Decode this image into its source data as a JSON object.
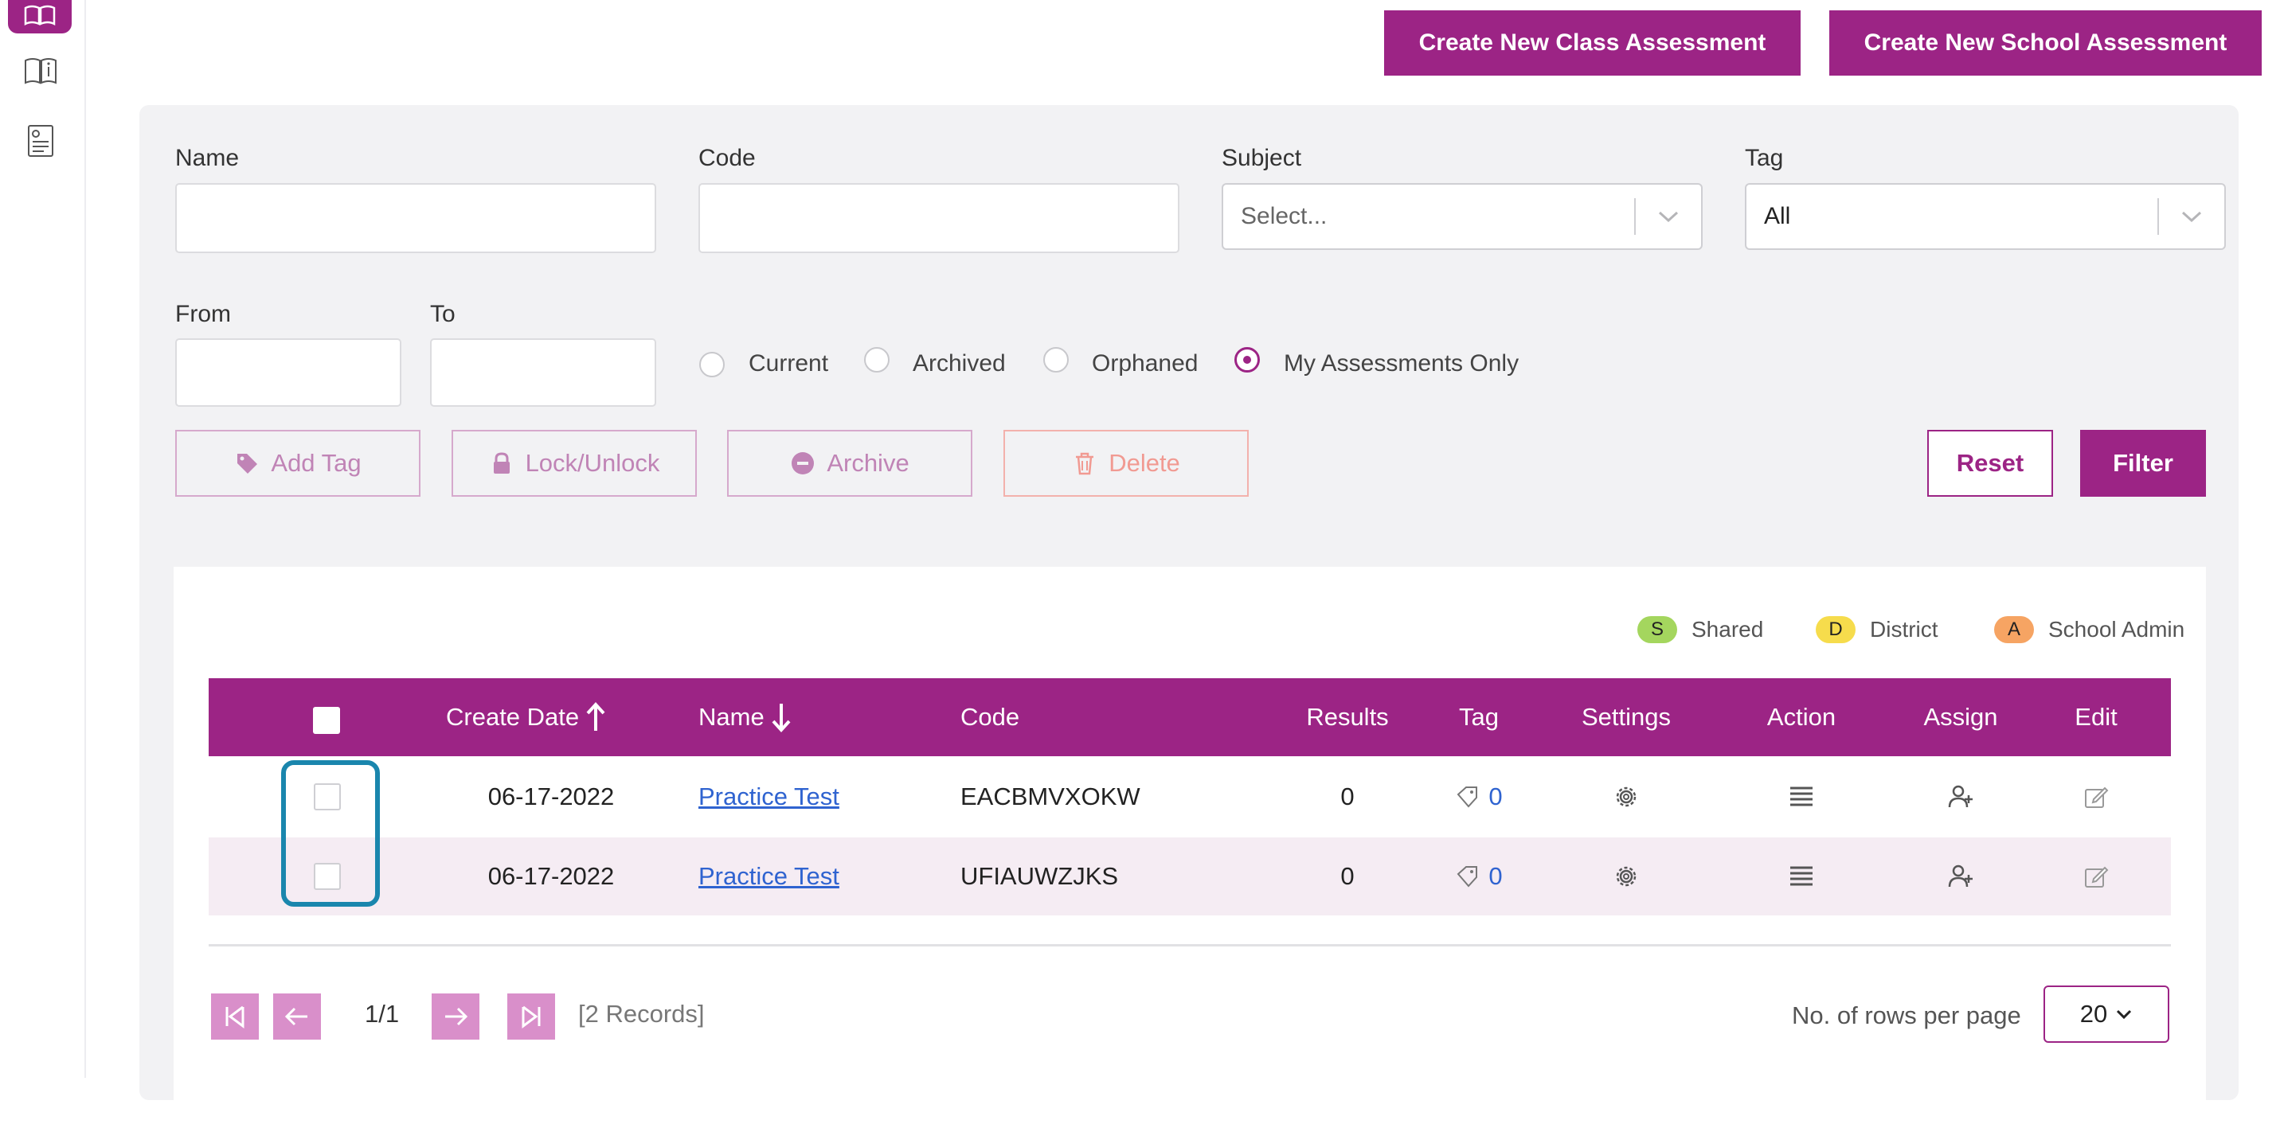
{
  "toolbar": {
    "create_class": "Create New Class Assessment",
    "create_school": "Create New School Assessment"
  },
  "filters": {
    "name_label": "Name",
    "code_label": "Code",
    "subject_label": "Subject",
    "subject_value": "Select...",
    "tag_label": "Tag",
    "tag_value": "All",
    "from_label": "From",
    "to_label": "To",
    "radios": [
      {
        "label": "Current",
        "selected": false
      },
      {
        "label": "Archived",
        "selected": false
      },
      {
        "label": "Orphaned",
        "selected": false
      },
      {
        "label": "My Assessments Only",
        "selected": true
      }
    ]
  },
  "actions": {
    "add_tag": "Add Tag",
    "lock": "Lock/Unlock",
    "archive": "Archive",
    "delete": "Delete",
    "reset": "Reset",
    "filter": "Filter"
  },
  "legend": [
    {
      "letter": "S",
      "label": "Shared",
      "color": "#a4d65e"
    },
    {
      "letter": "D",
      "label": "District",
      "color": "#f6dc4c"
    },
    {
      "letter": "A",
      "label": "School Admin",
      "color": "#f6a463"
    }
  ],
  "table": {
    "headers": {
      "create_date": "Create Date",
      "name": "Name",
      "code": "Code",
      "results": "Results",
      "tag": "Tag",
      "settings": "Settings",
      "action": "Action",
      "assign": "Assign",
      "edit": "Edit"
    },
    "rows": [
      {
        "date": "06-17-2022",
        "name": "Practice Test",
        "code": "EACBMVXOKW",
        "results": "0",
        "tags": "0"
      },
      {
        "date": "06-17-2022",
        "name": "Practice Test",
        "code": "UFIAUWZJKS",
        "results": "0",
        "tags": "0"
      }
    ]
  },
  "pagination": {
    "page": "1/1",
    "records": "[2 Records]",
    "rows_label": "No. of rows per page",
    "rows_value": "20"
  },
  "colors": {
    "brand": "#9c2485",
    "row_alt": "#f5ecf3",
    "highlight": "#1a86ad"
  }
}
